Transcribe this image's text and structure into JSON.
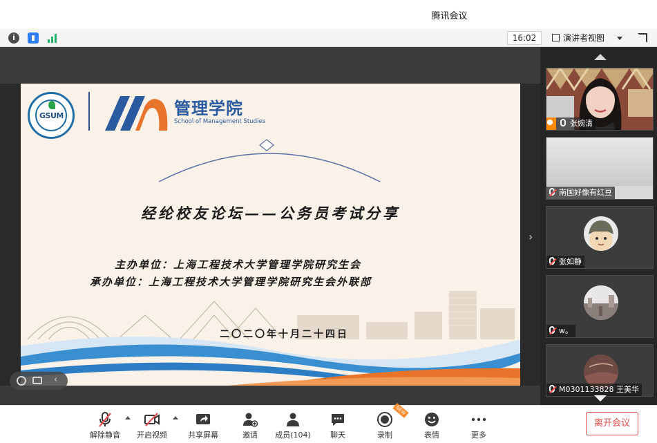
{
  "window": {
    "title": "腾讯会议"
  },
  "statusbar": {
    "time": "16:02",
    "view_mode": "演讲者视图"
  },
  "slide": {
    "logo_text": "GSUM",
    "school_cn": "管理学院",
    "school_en": "School of Management Studies",
    "title": "经纶校友论坛——公务员考试分享",
    "organizer": "主办单位：上海工程技术大学管理学院研究生会",
    "co_organizer": "承办单位：上海工程技术大学管理学院研究生会外联部",
    "date": "二〇二〇年十月二十四日"
  },
  "participants": [
    {
      "name": "张婉清",
      "muted": false,
      "host": true
    },
    {
      "name": "南国好像有红豆",
      "muted": true,
      "host": false
    },
    {
      "name": "张如静",
      "muted": true,
      "host": false
    },
    {
      "name": "w。",
      "muted": true,
      "host": false
    },
    {
      "name": "M0301133828 王美华",
      "muted": true,
      "host": false
    }
  ],
  "toolbar": {
    "unmute": "解除静音",
    "start_video": "开启视频",
    "share_screen": "共享屏幕",
    "invite": "邀请",
    "members": "成员(104)",
    "chat": "聊天",
    "record": "录制",
    "record_badge": "NEW",
    "reactions": "表情",
    "more": "更多",
    "leave": "离开会议"
  },
  "colors": {
    "accent": "#2f7df6",
    "leave": "#e34d4d",
    "slide_blue": "#2a5aa0",
    "wave_orange": "#e8732a"
  }
}
